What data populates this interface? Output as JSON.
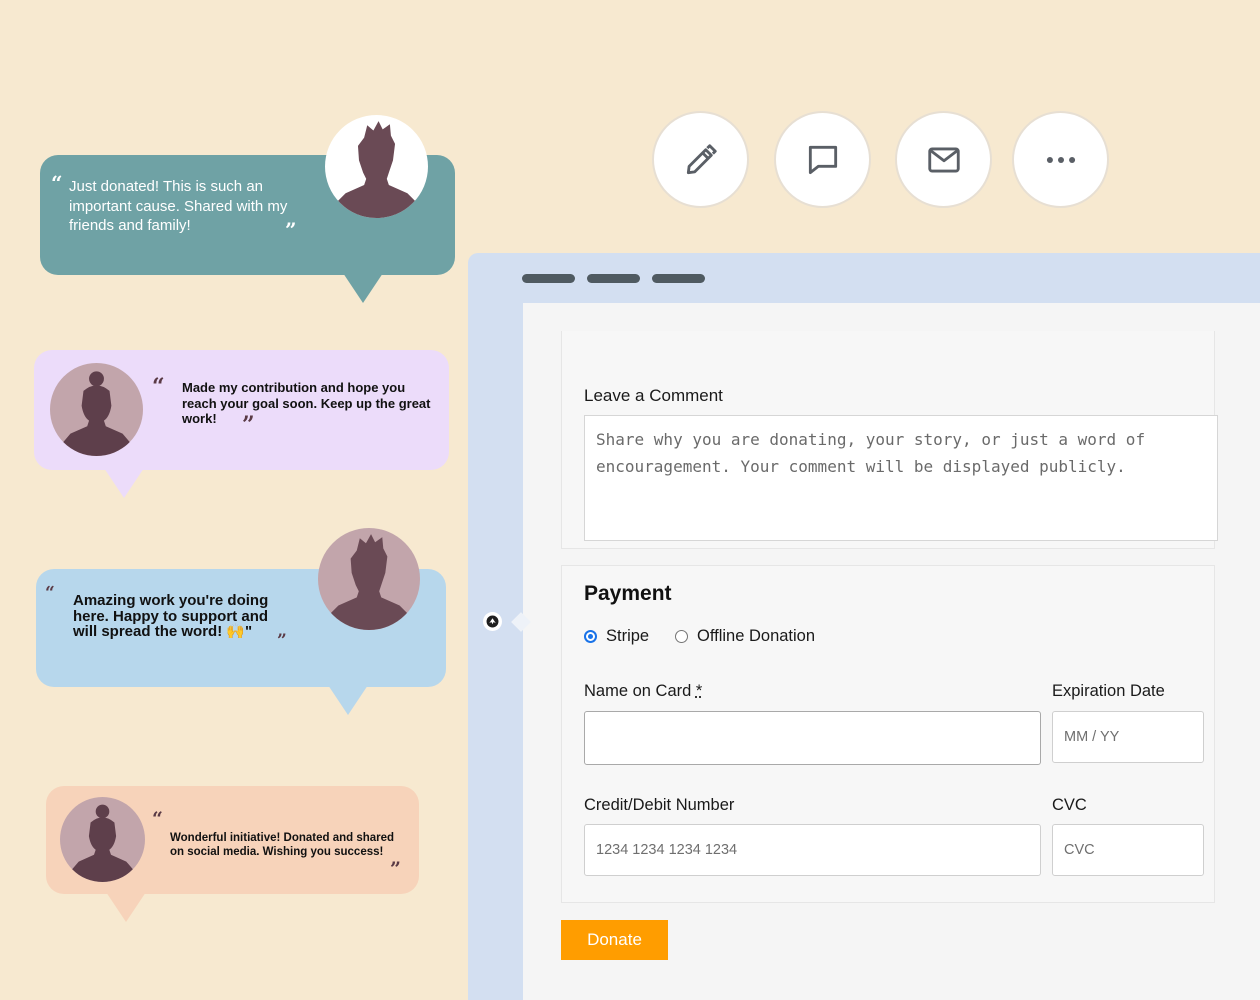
{
  "testimonials": [
    {
      "text": "Just donated! This is such an important cause. Shared with my friends and family!",
      "color": "#6fa2a5",
      "avatar": "male-silhouette"
    },
    {
      "text": "Made my contribution and hope you reach your goal soon. Keep up the great work!",
      "color": "#ecdcfa",
      "avatar": "female-silhouette"
    },
    {
      "text": "Amazing work you're doing here. Happy to support and will spread the word! 🙌\"",
      "color": "#b7d7ec",
      "avatar": "male-silhouette"
    },
    {
      "text": "Wonderful initiative! Donated and shared on social media. Wishing you success!",
      "color": "#f7d3ba",
      "avatar": "female-silhouette"
    }
  ],
  "quote_marks": {
    "open": "“",
    "close": "”"
  },
  "actions": [
    "pencil-icon",
    "comment-icon",
    "mail-icon",
    "more-icon"
  ],
  "form": {
    "comment_label": "Leave a Comment",
    "comment_placeholder": "Share why you are donating, your story, or just a word of encouragement. Your comment will be displayed publicly.",
    "payment_title": "Payment",
    "payment_methods": [
      {
        "label": "Stripe",
        "selected": true
      },
      {
        "label": "Offline Donation",
        "selected": false
      }
    ],
    "name_label": "Name on Card",
    "required_marker": "*",
    "name_value": "",
    "expiration_label": "Expiration Date",
    "expiration_placeholder": "MM / YY",
    "card_label": "Credit/Debit Number",
    "card_placeholder": "1234 1234 1234 1234",
    "cvc_label": "CVC",
    "cvc_placeholder": "CVC",
    "donate_label": "Donate"
  },
  "colors": {
    "background": "#f7e9d0",
    "accent": "#ff9d00",
    "browser_frame": "#d3dff1",
    "radio_selected": "#1a73e8"
  }
}
